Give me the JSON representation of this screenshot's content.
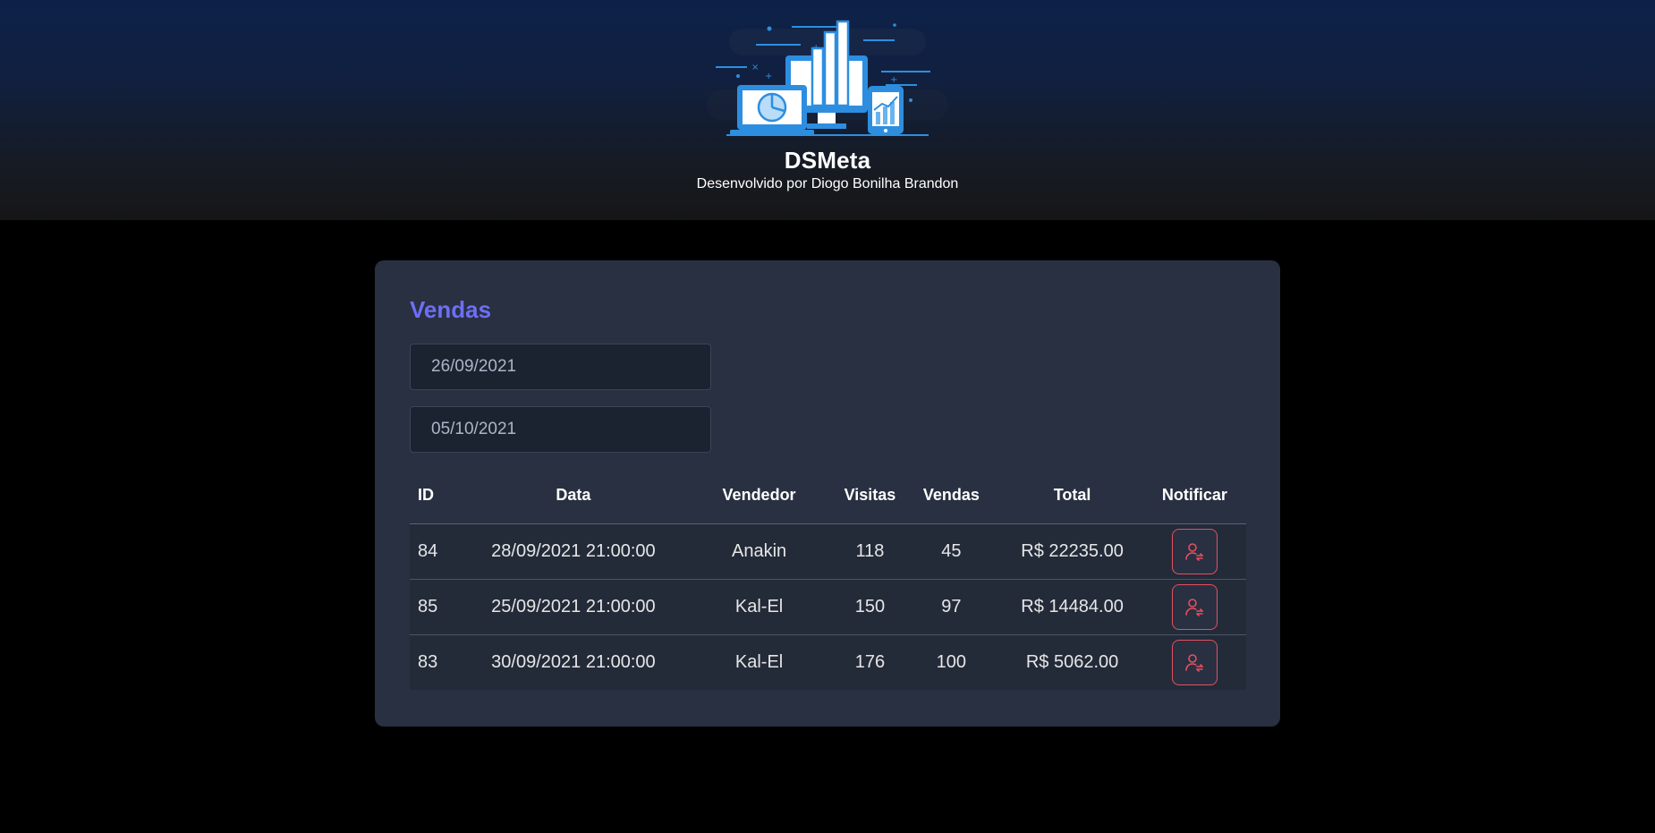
{
  "header": {
    "logo_icon": "dashboard-devices-illustration",
    "title": "DSMeta",
    "subtitle": "Desenvolvido por Diogo Bonilha Brandon"
  },
  "sales_card": {
    "title": "Vendas",
    "date_min": "26/09/2021",
    "date_max": "05/10/2021",
    "columns": [
      "ID",
      "Data",
      "Vendedor",
      "Visitas",
      "Vendas",
      "Total",
      "Notificar"
    ],
    "rows": [
      {
        "id": "84",
        "date": "28/09/2021 21:00:00",
        "seller": "Anakin",
        "visits": "118",
        "deals": "45",
        "total": "R$ 22235.00",
        "notify_icon": "user-notify-icon"
      },
      {
        "id": "85",
        "date": "25/09/2021 21:00:00",
        "seller": "Kal-El",
        "visits": "150",
        "deals": "97",
        "total": "R$ 14484.00",
        "notify_icon": "user-notify-icon"
      },
      {
        "id": "83",
        "date": "30/09/2021 21:00:00",
        "seller": "Kal-El",
        "visits": "176",
        "deals": "100",
        "total": "R$ 5062.00",
        "notify_icon": "user-notify-icon"
      }
    ]
  },
  "colors": {
    "accent": "#6e6ef5",
    "card_bg": "#283041",
    "notify": "#e5505f",
    "header_top": "#0d2148"
  }
}
